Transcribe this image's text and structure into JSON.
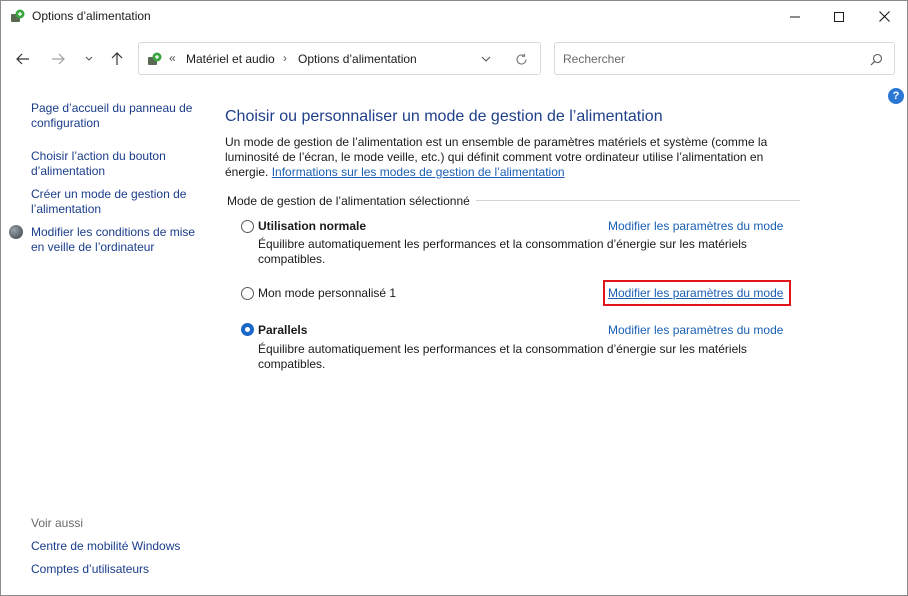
{
  "window": {
    "title": "Options d’alimentation"
  },
  "nav": {
    "breadcrumb_overflow": "«",
    "breadcrumbs": [
      "Matériel et audio",
      "Options d’alimentation"
    ],
    "separator": "›",
    "search_placeholder": "Rechercher"
  },
  "help": {
    "label": "?"
  },
  "sidebar": {
    "links": [
      "Page d’accueil du panneau de configuration",
      "Choisir l’action du bouton d’alimentation",
      "Créer un mode de gestion de l’alimentation",
      "Modifier les conditions de mise en veille de l’ordinateur"
    ],
    "see_also_label": "Voir aussi",
    "see_also_links": [
      "Centre de mobilité Windows",
      "Comptes d’utilisateurs"
    ]
  },
  "main": {
    "title": "Choisir ou personnaliser un mode de gestion de l’alimentation",
    "description": "Un mode de gestion de l’alimentation est un ensemble de paramètres matériels et système (comme la luminosité de l’écran, le mode veille, etc.) qui définit comment votre ordinateur utilise l’alimentation en énergie.",
    "info_link": "Informations sur les modes de gestion de l’alimentation",
    "group_label": "Mode de gestion de l’alimentation sélectionné",
    "plans": [
      {
        "name": "Utilisation normale",
        "selected": false,
        "description": "Équilibre automatiquement les performances et la consommation d’énergie sur les matériels compatibles.",
        "link": "Modifier les paramètres du mode"
      },
      {
        "name": "Mon mode personnalisé 1",
        "selected": false,
        "description": "",
        "link": "Modifier les paramètres du mode",
        "highlighted": true
      },
      {
        "name": "Parallels",
        "selected": true,
        "description": "Équilibre automatiquement les performances et la consommation d’énergie sur les matériels compatibles.",
        "link": "Modifier les paramètres du mode"
      }
    ]
  },
  "colors": {
    "link": "#1a5fb4",
    "title": "#1e3f8b",
    "radio_selected": "#1a67c8",
    "highlight": "#e0161b",
    "help": "#2a78d4"
  }
}
